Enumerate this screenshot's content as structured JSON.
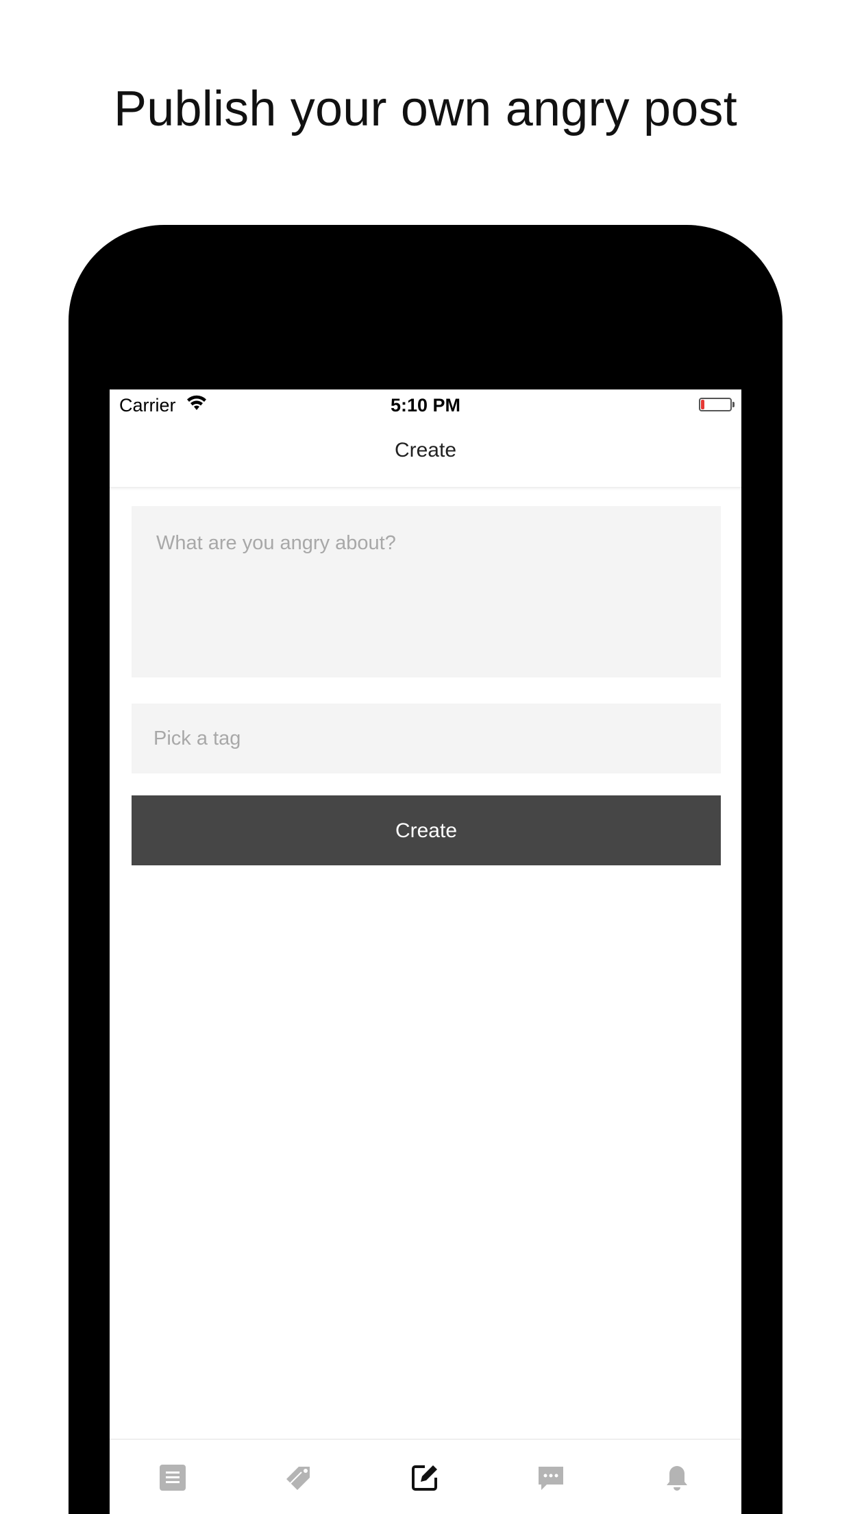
{
  "headline": "Publish your own angry post",
  "status_bar": {
    "carrier": "Carrier",
    "time": "5:10 PM",
    "battery_color": "#e53935"
  },
  "nav": {
    "title": "Create"
  },
  "form": {
    "post_placeholder": "What are you angry about?",
    "tag_placeholder": "Pick a tag",
    "create_label": "Create",
    "button_color": "#464646",
    "field_color": "#f4f4f4"
  },
  "tab_bar": {
    "items": [
      {
        "icon": "posts-list-icon",
        "active": false
      },
      {
        "icon": "tags-icon",
        "active": false
      },
      {
        "icon": "compose-icon",
        "active": true
      },
      {
        "icon": "messages-icon",
        "active": false
      },
      {
        "icon": "notifications-bell-icon",
        "active": false
      }
    ],
    "active_color": "#111111",
    "inactive_color": "#b4b4b4"
  }
}
